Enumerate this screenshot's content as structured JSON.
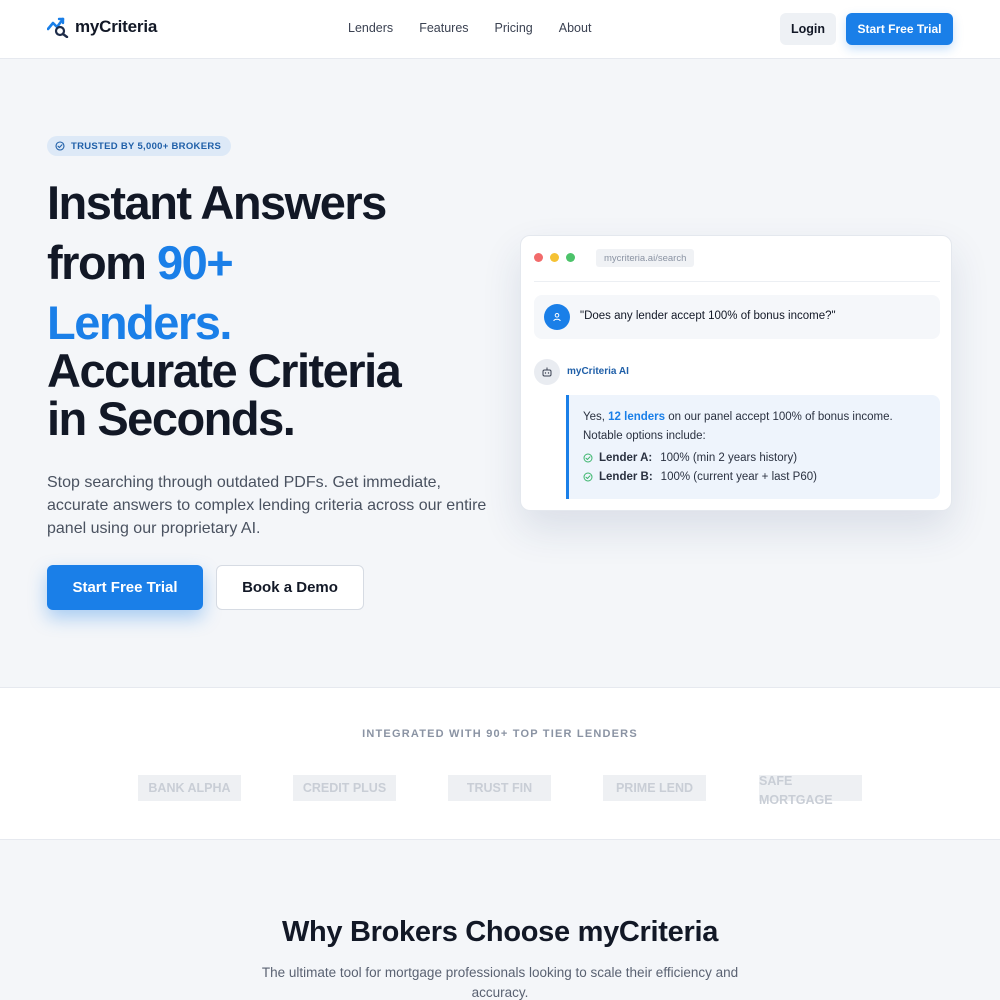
{
  "nav": {
    "brand": "myCriteria",
    "links": [
      "Lenders",
      "Features",
      "Pricing",
      "About"
    ],
    "login_label": "Login",
    "trial_label": "Start Free Trial"
  },
  "hero": {
    "badge": "TRUSTED BY 5,000+ BROKERS",
    "headline": {
      "line1": "Instant Answers",
      "line2_prefix": "from ",
      "line2_accent": "90+",
      "line3_accent": "Lenders.",
      "line4": "Accurate Criteria",
      "line5": "in Seconds."
    },
    "subtext": "Stop searching through outdated PDFs. Get immediate, accurate answers to complex lending criteria across our entire panel using our proprietary AI.",
    "primary_cta": "Start Free Trial",
    "secondary_cta": "Book a Demo"
  },
  "chat": {
    "url": "mycriteria.ai/search",
    "question": "\"Does any lender accept 100% of bonus income?\"",
    "ai_name": "myCriteria AI",
    "answer_pre": "Yes, ",
    "answer_highlight": "12 lenders",
    "answer_post": " on our panel accept 100% of bonus income. Notable options include:",
    "items": [
      {
        "lender": "Lender A:",
        "detail": "100% (min 2 years history)"
      },
      {
        "lender": "Lender B:",
        "detail": "100% (current year + last P60)"
      }
    ]
  },
  "lenders": {
    "title": "INTEGRATED WITH 90+ TOP TIER LENDERS",
    "names": [
      "BANK ALPHA",
      "CREDIT PLUS",
      "TRUST FIN",
      "PRIME LEND",
      "SAFE MORTGAGE"
    ]
  },
  "why": {
    "title": "Why Brokers Choose myCriteria",
    "subtitle": "The ultimate tool for mortgage professionals looking to scale their efficiency and accuracy."
  },
  "colors": {
    "accent": "#1a7fe8",
    "dot_red": "#f26b6b",
    "dot_yellow": "#f5c234",
    "dot_green": "#4cc36a",
    "check_green": "#3bb56c"
  }
}
